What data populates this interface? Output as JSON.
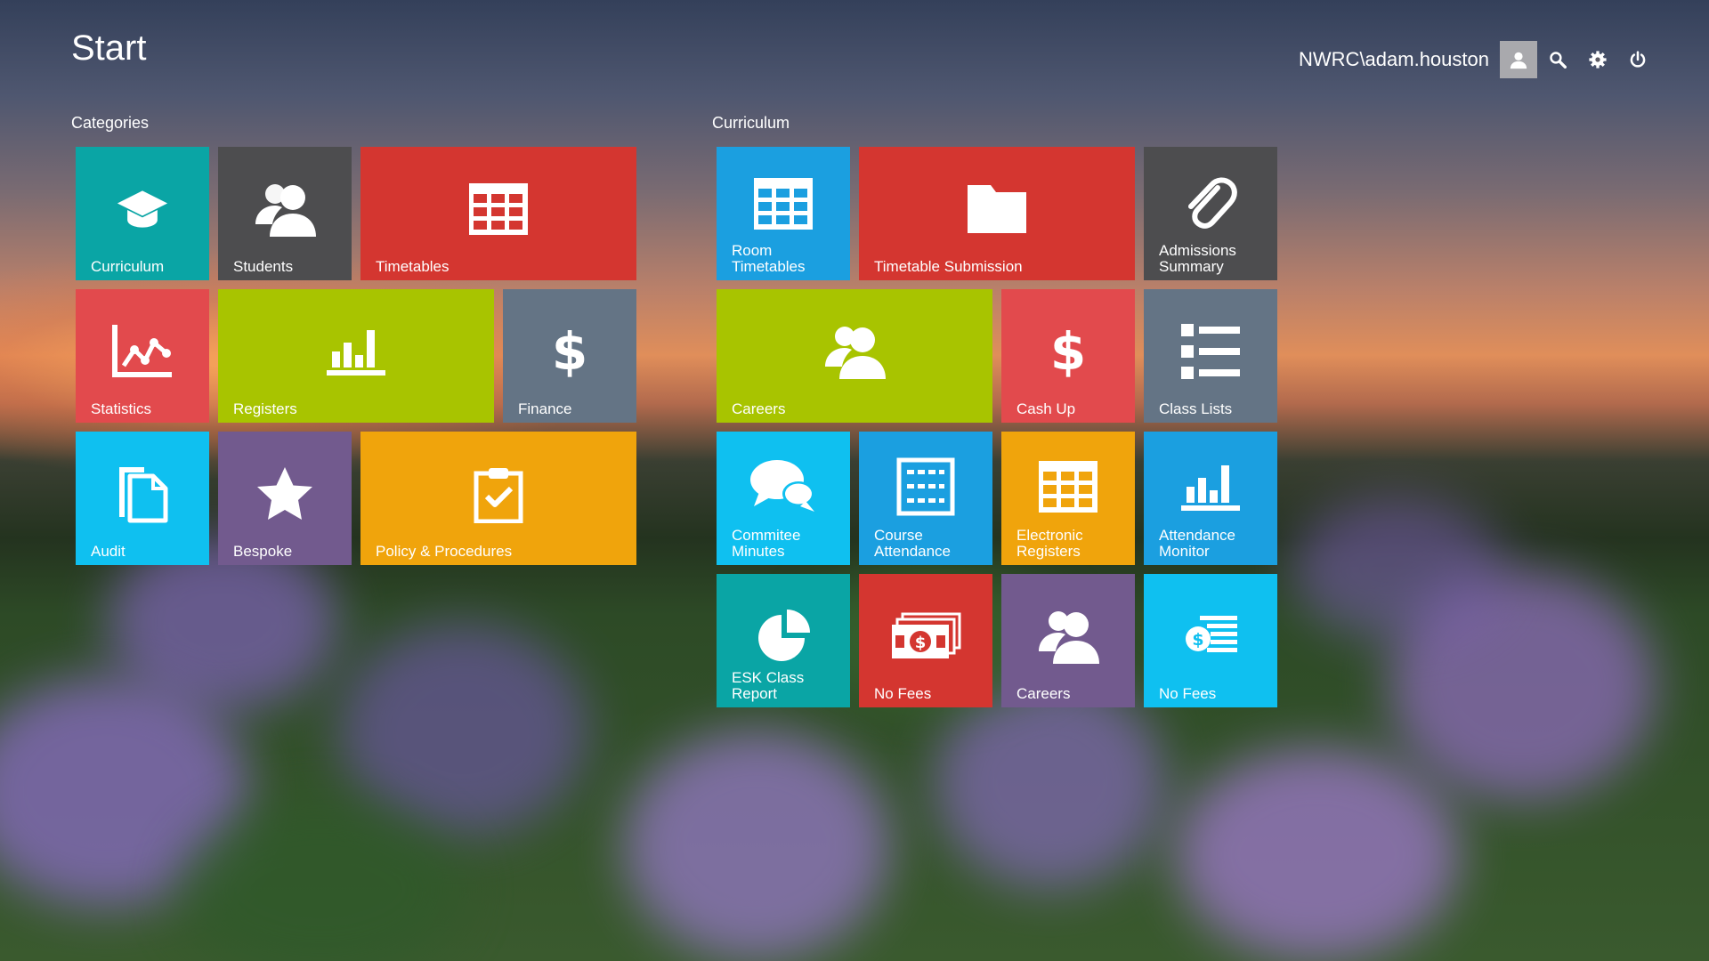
{
  "header": {
    "title": "Start",
    "username": "NWRC\\adam.houston",
    "icons": [
      "user-icon",
      "search-icon",
      "gear-icon",
      "power-icon"
    ]
  },
  "sections": {
    "categories": "Categories",
    "curriculum": "Curriculum"
  },
  "tiles": {
    "curriculum": {
      "label": "Curriculum",
      "color": "#0aa5a5",
      "icon": "graduation-cap-icon"
    },
    "students": {
      "label": "Students",
      "color": "#4d4d4f",
      "icon": "users-icon"
    },
    "timetables": {
      "label": "Timetables",
      "color": "#d43630",
      "icon": "grid-icon"
    },
    "statistics": {
      "label": "Statistics",
      "color": "#e24a4d",
      "icon": "line-chart-icon"
    },
    "registers": {
      "label": "Registers",
      "color": "#a8c400",
      "icon": "bar-chart-icon"
    },
    "finance": {
      "label": "Finance",
      "color": "#647485",
      "icon": "dollar-icon"
    },
    "audit": {
      "label": "Audit",
      "color": "#0fc0f0",
      "icon": "documents-icon"
    },
    "bespoke": {
      "label": "Bespoke",
      "color": "#725a8e",
      "icon": "star-icon"
    },
    "policy": {
      "label": "Policy & Procedures",
      "color": "#f0a40c",
      "icon": "clipboard-check-icon"
    },
    "room_timetables": {
      "label": "Room\nTimetables",
      "color": "#1b9fe0",
      "icon": "grid-icon"
    },
    "timetable_submission": {
      "label": "Timetable Submission",
      "color": "#d43630",
      "icon": "folder-icon"
    },
    "admissions_summary": {
      "label": "Admissions\nSummary",
      "color": "#4d4d4f",
      "icon": "paperclip-icon"
    },
    "careers_wide": {
      "label": "Careers",
      "color": "#a8c400",
      "icon": "users-icon"
    },
    "cash_up": {
      "label": "Cash Up",
      "color": "#e24a4d",
      "icon": "dollar-icon"
    },
    "class_lists": {
      "label": "Class Lists",
      "color": "#647485",
      "icon": "list-icon"
    },
    "committee_minutes": {
      "label": "Commitee\nMinutes",
      "color": "#0fc0f0",
      "icon": "chat-bubbles-icon"
    },
    "course_attendance": {
      "label": "Course\nAttendance",
      "color": "#1b9fe0",
      "icon": "calendar-icon"
    },
    "electronic_registers": {
      "label": "Electronic\nRegisters",
      "color": "#f0a40c",
      "icon": "grid-icon"
    },
    "attendance_monitor": {
      "label": "Attendance\nMonitor",
      "color": "#1b9fe0",
      "icon": "bar-chart-icon"
    },
    "esk_class_report": {
      "label": "ESK Class Report",
      "color": "#0aa5a5",
      "icon": "pie-chart-icon"
    },
    "no_fees_money": {
      "label": "No Fees",
      "color": "#d43630",
      "icon": "money-icon"
    },
    "careers_small": {
      "label": "Careers",
      "color": "#725a8e",
      "icon": "users-icon"
    },
    "no_fees_invoice": {
      "label": "No Fees",
      "color": "#0fc0f0",
      "icon": "invoice-icon"
    }
  }
}
